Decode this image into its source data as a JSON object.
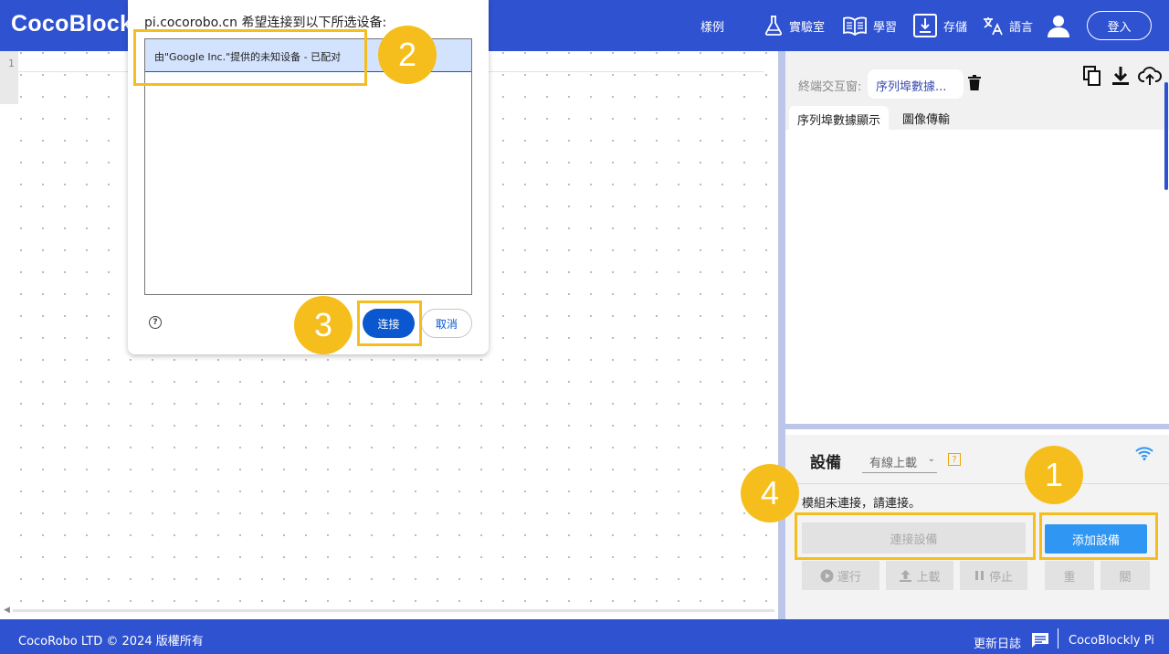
{
  "header": {
    "logo": "CocoBlock",
    "nav": [
      {
        "label": "樣例",
        "icon": ""
      },
      {
        "label": "實驗室",
        "icon": "flask-icon"
      },
      {
        "label": "學習",
        "icon": "book-icon"
      },
      {
        "label": "存儲",
        "icon": "save-icon"
      },
      {
        "label": "語言",
        "icon": "translate-icon"
      }
    ],
    "login": "登入"
  },
  "editor": {
    "line_number": "1"
  },
  "dialog": {
    "title": "pi.cocorobo.cn 希望连接到以下所选设备:",
    "device": "由\"Google Inc.\"提供的未知设备 - 已配对",
    "connect": "连接",
    "cancel": "取消",
    "help": "?"
  },
  "terminal": {
    "label": "終端交互窗:",
    "chip": "序列埠數據...",
    "tabs": [
      "序列埠數據顯示",
      "圖像傳輸"
    ]
  },
  "device": {
    "title": "設備",
    "mode": "有線上載",
    "help": "?",
    "status": "模組未連接，請連接。",
    "connect_button": "連接設備",
    "add_button": "添加設備",
    "controls": [
      "運行",
      "上載",
      "停止",
      "重",
      "關"
    ]
  },
  "footer": {
    "copyright": "CocoRobo LTD © 2024 版權所有",
    "changelog": "更新日誌",
    "product": "CocoBlockly Pi"
  },
  "annotations": [
    "1",
    "2",
    "3",
    "4"
  ],
  "colors": {
    "brand": "#2f52d1",
    "highlight": "#f5be1c",
    "primary_button": "#0b57d0",
    "add_button": "#2f96f3"
  }
}
